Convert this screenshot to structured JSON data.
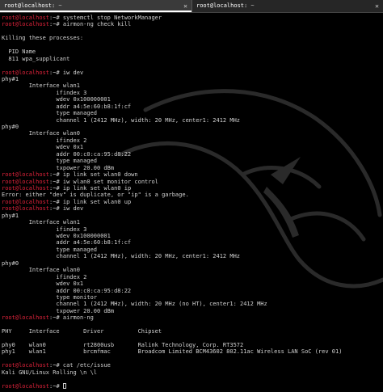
{
  "tabs": [
    {
      "name": "root@localhost:",
      "rest": " ~",
      "active": true,
      "close": "✕"
    },
    {
      "name": "root@localhost:",
      "rest": " ~",
      "active": false,
      "close": "✕"
    }
  ],
  "colors": {
    "prompt": "#e0233b",
    "text": "#d0d0d0",
    "background": "#000000"
  },
  "prompt_user": "root@localhost",
  "prompt_suffix": ":~#",
  "lines": [
    {
      "type": "cmd",
      "text": " systemctl stop NetworkManager"
    },
    {
      "type": "cmd",
      "text": " airmon-ng check kill"
    },
    {
      "type": "out",
      "text": ""
    },
    {
      "type": "out",
      "text": "Killing these processes:"
    },
    {
      "type": "out",
      "text": ""
    },
    {
      "type": "out",
      "text": "  PID Name"
    },
    {
      "type": "out",
      "text": "  811 wpa_supplicant"
    },
    {
      "type": "out",
      "text": ""
    },
    {
      "type": "cmd",
      "text": " iw dev"
    },
    {
      "type": "out",
      "text": "phy#1"
    },
    {
      "type": "out",
      "text": "        Interface wlan1"
    },
    {
      "type": "out",
      "text": "                ifindex 3"
    },
    {
      "type": "out",
      "text": "                wdev 0x100000001"
    },
    {
      "type": "out",
      "text": "                addr a4:5e:60:b8:1f:cf"
    },
    {
      "type": "out",
      "text": "                type managed"
    },
    {
      "type": "out",
      "text": "                channel 1 (2412 MHz), width: 20 MHz, center1: 2412 MHz"
    },
    {
      "type": "out",
      "text": "phy#0"
    },
    {
      "type": "out",
      "text": "        Interface wlan0"
    },
    {
      "type": "out",
      "text": "                ifindex 2"
    },
    {
      "type": "out",
      "text": "                wdev 0x1"
    },
    {
      "type": "out",
      "text": "                addr 00:c0:ca:95:d8:22"
    },
    {
      "type": "out",
      "text": "                type managed"
    },
    {
      "type": "out",
      "text": "                txpower 20.00 dBm"
    },
    {
      "type": "cmd",
      "text": " ip link set wlan0 down"
    },
    {
      "type": "cmd",
      "text": " iw wlan0 set monitor control"
    },
    {
      "type": "cmd",
      "text": " ip link set wlan0 ip"
    },
    {
      "type": "out",
      "text": "Error: either \"dev\" is duplicate, or \"ip\" is a garbage."
    },
    {
      "type": "cmd",
      "text": " ip link set wlan0 up"
    },
    {
      "type": "cmd",
      "text": " iw dev"
    },
    {
      "type": "out",
      "text": "phy#1"
    },
    {
      "type": "out",
      "text": "        Interface wlan1"
    },
    {
      "type": "out",
      "text": "                ifindex 3"
    },
    {
      "type": "out",
      "text": "                wdev 0x100000001"
    },
    {
      "type": "out",
      "text": "                addr a4:5e:60:b8:1f:cf"
    },
    {
      "type": "out",
      "text": "                type managed"
    },
    {
      "type": "out",
      "text": "                channel 1 (2412 MHz), width: 20 MHz, center1: 2412 MHz"
    },
    {
      "type": "out",
      "text": "phy#0"
    },
    {
      "type": "out",
      "text": "        Interface wlan0"
    },
    {
      "type": "out",
      "text": "                ifindex 2"
    },
    {
      "type": "out",
      "text": "                wdev 0x1"
    },
    {
      "type": "out",
      "text": "                addr 00:c0:ca:95:d8:22"
    },
    {
      "type": "out",
      "text": "                type monitor"
    },
    {
      "type": "out",
      "text": "                channel 1 (2412 MHz), width: 20 MHz (no HT), center1: 2412 MHz"
    },
    {
      "type": "out",
      "text": "                txpower 20.00 dBm"
    },
    {
      "type": "cmd",
      "text": " airmon-ng"
    },
    {
      "type": "out",
      "text": ""
    },
    {
      "type": "out",
      "text": "PHY     Interface       Driver          Chipset"
    },
    {
      "type": "out",
      "text": ""
    },
    {
      "type": "out",
      "text": "phy0    wlan0           rt2800usb       Ralink Technology, Corp. RT3572"
    },
    {
      "type": "out",
      "text": "phy1    wlan1           brcmfmac        Broadcom Limited BCM43602 802.11ac Wireless LAN SoC (rev 01)"
    },
    {
      "type": "out",
      "text": ""
    },
    {
      "type": "cmd",
      "text": " cat /etc/issue"
    },
    {
      "type": "out",
      "text": "Kali GNU/Linux Rolling \\n \\l"
    },
    {
      "type": "out",
      "text": ""
    },
    {
      "type": "cmd",
      "text": " ",
      "cursor": true
    }
  ]
}
